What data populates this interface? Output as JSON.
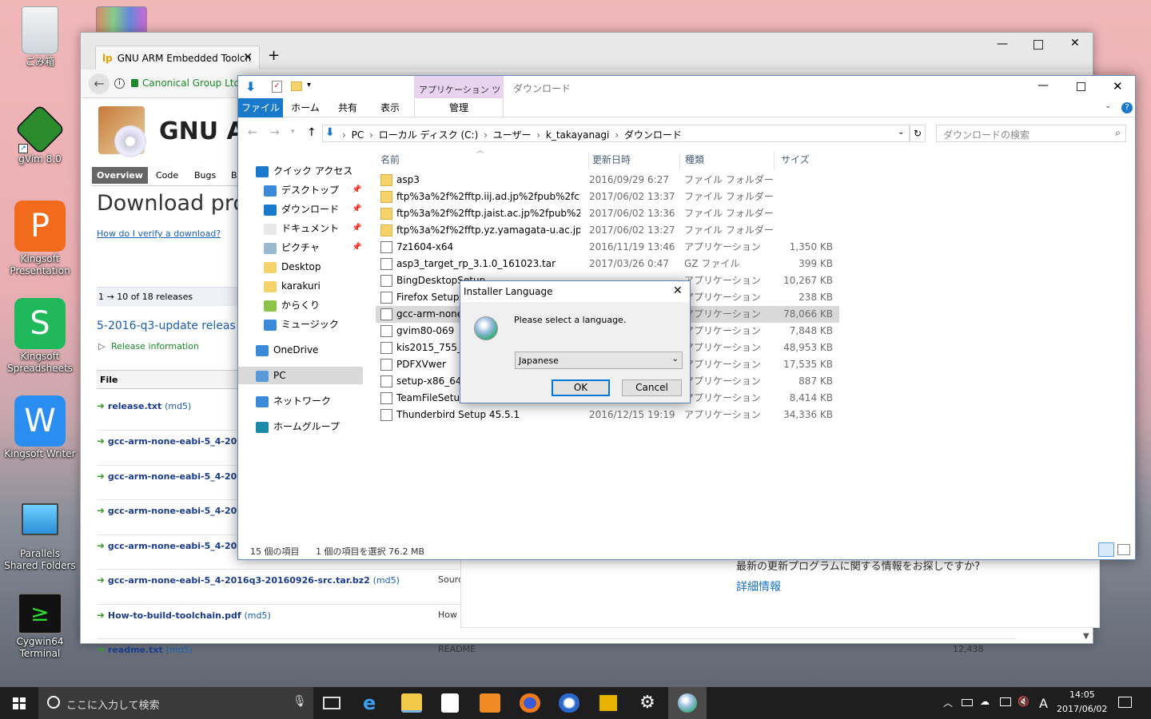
{
  "desktop": {
    "icons": [
      {
        "label": "ごみ箱"
      },
      {
        "label": "gVim 8.0"
      },
      {
        "label": "Kingsoft Presentation"
      },
      {
        "label": "Kingsoft Spreadsheets"
      },
      {
        "label": "Kingsoft Writer"
      },
      {
        "label": "Parallels Shared Folders"
      },
      {
        "label": "Cygwin64 Terminal"
      }
    ]
  },
  "browser": {
    "tab_title": "GNU ARM Embedded Toolch",
    "security_label": "Canonical Group Ltd",
    "page_title": "GNU AR",
    "nav": [
      "Overview",
      "Code",
      "Bugs",
      "Bl"
    ],
    "heading": "Download pro",
    "verify_link": "How do I verify a download?",
    "range_text": "1 → 10 of 18 releases",
    "release_title": "5-2016-q3-update releas",
    "release_info": "Release information",
    "file_col": "File",
    "files": [
      {
        "name": "release.txt",
        "md5": "(md5)"
      },
      {
        "name": "gcc-arm-none-eabi-5_4-2016",
        "md5": ""
      },
      {
        "name": "gcc-arm-none-eabi-5_4-2016",
        "md5": ""
      },
      {
        "name": "gcc-arm-none-eabi-5_4-2016",
        "md5": ""
      },
      {
        "name": "gcc-arm-none-eabi-5_4-2016",
        "md5": ""
      },
      {
        "name": "gcc-arm-none-eabi-5_4-2016q3-20160926-src.tar.bz2",
        "md5": "(md5)",
        "desc": "Sourc"
      },
      {
        "name": "How-to-build-toolchain.pdf",
        "md5": "(md5)",
        "desc": "How"
      },
      {
        "name": "readme.txt",
        "md5": "(md5)",
        "desc": "README",
        "size": "12,438"
      }
    ],
    "banner_text": "最新の更新プログラムに関する情報をお探しですか?",
    "banner_link": "詳細情報"
  },
  "explorer": {
    "contextual_tab": "アプリケーション ツール",
    "title": "ダウンロード",
    "ribbon_tabs": [
      "ファイル",
      "ホーム",
      "共有",
      "表示"
    ],
    "manage_tab": "管理",
    "breadcrumb": [
      "PC",
      "ローカル ディスク (C:)",
      "ユーザー",
      "k_takayanagi",
      "ダウンロード"
    ],
    "search_placeholder": "ダウンロードの検索",
    "columns": {
      "name": "名前",
      "date": "更新日時",
      "type": "種類",
      "size": "サイズ"
    },
    "nav": [
      {
        "label": "クイック アクセス"
      },
      {
        "label": "デスクトップ"
      },
      {
        "label": "ダウンロード"
      },
      {
        "label": "ドキュメント"
      },
      {
        "label": "ピクチャ"
      },
      {
        "label": "Desktop"
      },
      {
        "label": "karakuri"
      },
      {
        "label": "からくり"
      },
      {
        "label": "ミュージック"
      },
      {
        "label": "OneDrive"
      },
      {
        "label": "PC"
      },
      {
        "label": "ネットワーク"
      },
      {
        "label": "ホームグループ"
      }
    ],
    "files": [
      {
        "name": "asp3",
        "date": "2016/09/29 6:27",
        "type": "ファイル フォルダー",
        "size": "",
        "kind": "folder"
      },
      {
        "name": "ftp%3a%2f%2fftp.iij.ad.jp%2fpub%2fcyg...",
        "date": "2017/06/02 13:37",
        "type": "ファイル フォルダー",
        "size": "",
        "kind": "folder"
      },
      {
        "name": "ftp%3a%2f%2fftp.jaist.ac.jp%2fpub%2fcy...",
        "date": "2017/06/02 13:36",
        "type": "ファイル フォルダー",
        "size": "",
        "kind": "folder"
      },
      {
        "name": "ftp%3a%2f%2fftp.yz.yamagata-u.ac.jp%2...",
        "date": "2017/06/02 13:27",
        "type": "ファイル フォルダー",
        "size": "",
        "kind": "folder"
      },
      {
        "name": "7z1604-x64",
        "date": "2016/11/19 13:46",
        "type": "アプリケーション",
        "size": "1,350 KB",
        "kind": "app"
      },
      {
        "name": "asp3_target_rp_3.1.0_161023.tar",
        "date": "2017/03/26 0:47",
        "type": "GZ ファイル",
        "size": "399 KB",
        "kind": "app"
      },
      {
        "name": "BingDesktopSetup",
        "date": "",
        "type": "アプリケーション",
        "size": "10,267 KB",
        "kind": "app"
      },
      {
        "name": "Firefox Setup S",
        "date": "",
        "type": "アプリケーション",
        "size": "238 KB",
        "kind": "app"
      },
      {
        "name": "gcc-arm-none-",
        "date": "",
        "type": "アプリケーション",
        "size": "78,066 KB",
        "kind": "app",
        "selected": true
      },
      {
        "name": "gvim80-069",
        "date": "",
        "type": "アプリケーション",
        "size": "7,848 KB",
        "kind": "app"
      },
      {
        "name": "kis2015_755_38",
        "date": "",
        "type": "アプリケーション",
        "size": "48,953 KB",
        "kind": "app"
      },
      {
        "name": "PDFXVwer",
        "date": "",
        "type": "アプリケーション",
        "size": "17,535 KB",
        "kind": "app"
      },
      {
        "name": "setup-x86_64",
        "date": "",
        "type": "アプリケーション",
        "size": "887 KB",
        "kind": "app"
      },
      {
        "name": "TeamFileSetup-",
        "date": "",
        "type": "アプリケーション",
        "size": "8,414 KB",
        "kind": "app"
      },
      {
        "name": "Thunderbird Setup 45.5.1",
        "date": "2016/12/15 19:19",
        "type": "アプリケーション",
        "size": "34,336 KB",
        "kind": "app"
      }
    ],
    "status_count": "15 個の項目",
    "status_selected": "1 個の項目を選択  76.2 MB"
  },
  "dialog": {
    "title": "Installer Language",
    "prompt": "Please select a language.",
    "selected_language": "Japanese",
    "ok_label": "OK",
    "cancel_label": "Cancel"
  },
  "taskbar": {
    "search_placeholder": "ここに入力して検索",
    "ime": "A",
    "time": "14:05",
    "date": "2017/06/02"
  },
  "colors": {
    "explorer_accent": "#1979ca",
    "contextual_tab": "#e8d4ef",
    "taskbar": "#1e1e1e",
    "selection": "#d9d9d9"
  }
}
